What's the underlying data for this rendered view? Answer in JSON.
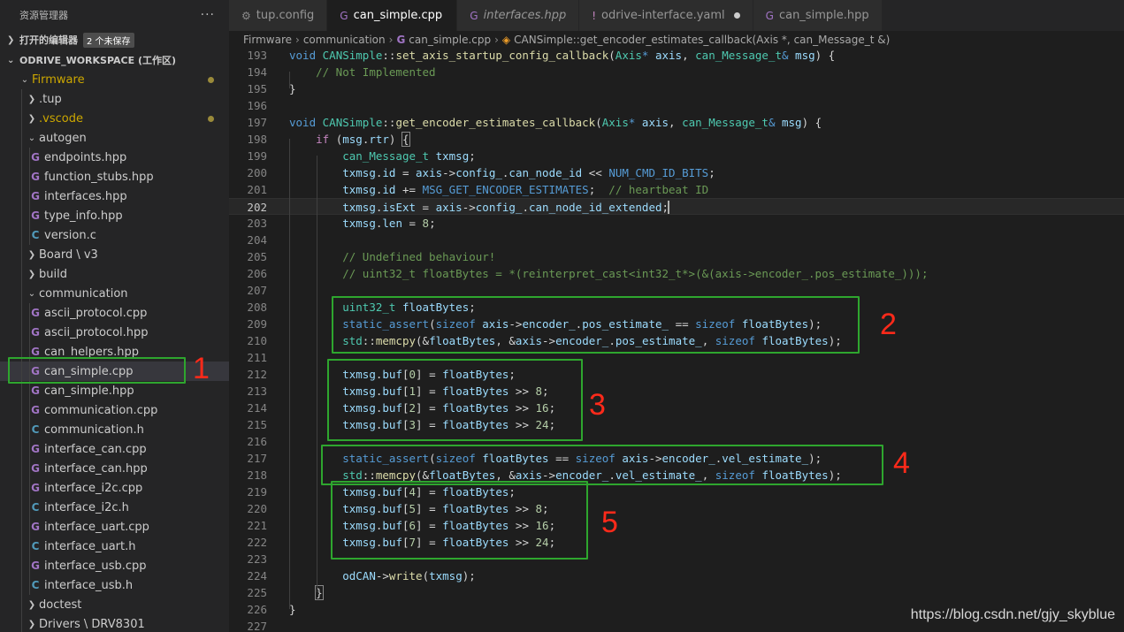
{
  "explorer": {
    "title": "资源管理器",
    "more_icon": "ellipsis-icon",
    "open_editors_label": "打开的编辑器",
    "unsaved_badge": "2 个未保存",
    "workspace_label": "ODRIVE_WORKSPACE (工作区)",
    "tree": [
      {
        "label": "Firmware",
        "depth": 1,
        "chev": "v",
        "modified": true
      },
      {
        "label": ".tup",
        "depth": 2,
        "chev": ">"
      },
      {
        "label": ".vscode",
        "depth": 2,
        "chev": ">",
        "modified": true
      },
      {
        "label": "autogen",
        "depth": 2,
        "chev": "v"
      },
      {
        "label": "endpoints.hpp",
        "depth": 3,
        "icon": "cpp"
      },
      {
        "label": "function_stubs.hpp",
        "depth": 3,
        "icon": "cpp"
      },
      {
        "label": "interfaces.hpp",
        "depth": 3,
        "icon": "cpp"
      },
      {
        "label": "type_info.hpp",
        "depth": 3,
        "icon": "cpp"
      },
      {
        "label": "version.c",
        "depth": 3,
        "icon": "c"
      },
      {
        "label": "Board \\ v3",
        "depth": 2,
        "chev": ">"
      },
      {
        "label": "build",
        "depth": 2,
        "chev": ">"
      },
      {
        "label": "communication",
        "depth": 2,
        "chev": "v"
      },
      {
        "label": "ascii_protocol.cpp",
        "depth": 3,
        "icon": "cpp"
      },
      {
        "label": "ascii_protocol.hpp",
        "depth": 3,
        "icon": "cpp"
      },
      {
        "label": "can_helpers.hpp",
        "depth": 3,
        "icon": "cpp"
      },
      {
        "label": "can_simple.cpp",
        "depth": 3,
        "icon": "cpp",
        "selected": true
      },
      {
        "label": "can_simple.hpp",
        "depth": 3,
        "icon": "cpp"
      },
      {
        "label": "communication.cpp",
        "depth": 3,
        "icon": "cpp"
      },
      {
        "label": "communication.h",
        "depth": 3,
        "icon": "c"
      },
      {
        "label": "interface_can.cpp",
        "depth": 3,
        "icon": "cpp"
      },
      {
        "label": "interface_can.hpp",
        "depth": 3,
        "icon": "cpp"
      },
      {
        "label": "interface_i2c.cpp",
        "depth": 3,
        "icon": "cpp"
      },
      {
        "label": "interface_i2c.h",
        "depth": 3,
        "icon": "c"
      },
      {
        "label": "interface_uart.cpp",
        "depth": 3,
        "icon": "cpp"
      },
      {
        "label": "interface_uart.h",
        "depth": 3,
        "icon": "c"
      },
      {
        "label": "interface_usb.cpp",
        "depth": 3,
        "icon": "cpp"
      },
      {
        "label": "interface_usb.h",
        "depth": 3,
        "icon": "c"
      },
      {
        "label": "doctest",
        "depth": 2,
        "chev": ">"
      },
      {
        "label": "Drivers \\ DRV8301",
        "depth": 2,
        "chev": ">"
      }
    ]
  },
  "tabs": [
    {
      "label": "tup.config",
      "icon": "gear-icon",
      "glyph": "⚙",
      "color": "#8a8a8a"
    },
    {
      "label": "can_simple.cpp",
      "icon": "cpp-file-icon",
      "glyph": "G",
      "color": "#a074c4",
      "active": true,
      "dot": true
    },
    {
      "label": "interfaces.hpp",
      "icon": "cpp-file-icon",
      "glyph": "G",
      "color": "#a074c4",
      "italic": true
    },
    {
      "label": "odrive-interface.yaml",
      "icon": "yaml-file-icon",
      "glyph": "!",
      "color": "#c586c0",
      "dot": true
    },
    {
      "label": "can_simple.hpp",
      "icon": "cpp-file-icon",
      "glyph": "G",
      "color": "#a074c4"
    }
  ],
  "breadcrumb": {
    "parts": [
      "Firmware",
      "communication",
      "can_simple.cpp"
    ],
    "symbol": "CANSimple::get_encoder_estimates_callback(Axis *, can_Message_t &)"
  },
  "code_lines": [
    {
      "n": "193",
      "html": "<span class='kw'>void</span> <span class='ty'>CANSimple</span>::<span class='fn'>set_axis_startup_config_callback</span>(<span class='ty'>Axis</span><span class='kw'>*</span> <span class='var'>axis</span>, <span class='ty'>can_Message_t</span><span class='kw'>&amp;</span> <span class='var'>msg</span>) {"
    },
    {
      "n": "194",
      "html": "    <span class='cm'>// Not Implemented</span>"
    },
    {
      "n": "195",
      "html": "}"
    },
    {
      "n": "196",
      "html": ""
    },
    {
      "n": "197",
      "html": "<span class='kw'>void</span> <span class='ty'>CANSimple</span>::<span class='fn'>get_encoder_estimates_callback</span>(<span class='ty'>Axis</span><span class='kw'>*</span> <span class='var'>axis</span>, <span class='ty'>can_Message_t</span><span class='kw'>&amp;</span> <span class='var'>msg</span>) {"
    },
    {
      "n": "198",
      "html": "    <span class='ctl'>if</span> (<span class='var'>msg</span>.<span class='var'>rtr</span>) <span class='brk'>{</span>"
    },
    {
      "n": "199",
      "html": "        <span class='ty'>can_Message_t</span> <span class='var'>txmsg</span>;"
    },
    {
      "n": "200",
      "html": "        <span class='var'>txmsg</span>.<span class='var'>id</span> = <span class='var'>axis</span>-&gt;<span class='var'>config_</span>.<span class='var'>can_node_id</span> &lt;&lt; <span class='mac'>NUM_CMD_ID_BITS</span>;"
    },
    {
      "n": "201",
      "html": "        <span class='var'>txmsg</span>.<span class='var'>id</span> += <span class='mac'>MSG_GET_ENCODER_ESTIMATES</span>;  <span class='cm'>// heartbeat ID</span>"
    },
    {
      "n": "202",
      "html": "        <span class='var'>txmsg</span>.<span class='var'>isExt</span> = <span class='var'>axis</span>-&gt;<span class='var'>config_</span>.<span class='var'>can_node_id_extended</span>;<span class='cur'></span>",
      "current": true
    },
    {
      "n": "203",
      "html": "        <span class='var'>txmsg</span>.<span class='var'>len</span> = <span class='num'>8</span>;"
    },
    {
      "n": "204",
      "html": ""
    },
    {
      "n": "205",
      "html": "        <span class='cm'>// Undefined behaviour!</span>"
    },
    {
      "n": "206",
      "html": "        <span class='cm'>// uint32_t floatBytes = *(reinterpret_cast&lt;int32_t*&gt;(&amp;(axis-&gt;encoder_.pos_estimate_)));</span>"
    },
    {
      "n": "207",
      "html": ""
    },
    {
      "n": "208",
      "html": "        <span class='ty'>uint32_t</span> <span class='var'>floatBytes</span>;"
    },
    {
      "n": "209",
      "html": "        <span class='kw'>static_assert</span>(<span class='kw'>sizeof</span> <span class='var'>axis</span>-&gt;<span class='var'>encoder_</span>.<span class='var'>pos_estimate_</span> == <span class='kw'>sizeof</span> <span class='var'>floatBytes</span>);"
    },
    {
      "n": "210",
      "html": "        <span class='ty'>std</span>::<span class='fn'>memcpy</span>(&amp;<span class='var'>floatBytes</span>, &amp;<span class='var'>axis</span>-&gt;<span class='var'>encoder_</span>.<span class='var'>pos_estimate_</span>, <span class='kw'>sizeof</span> <span class='var'>floatBytes</span>);"
    },
    {
      "n": "211",
      "html": ""
    },
    {
      "n": "212",
      "html": "        <span class='var'>txmsg</span>.<span class='var'>buf</span>[<span class='num'>0</span>] = <span class='var'>floatBytes</span>;"
    },
    {
      "n": "213",
      "html": "        <span class='var'>txmsg</span>.<span class='var'>buf</span>[<span class='num'>1</span>] = <span class='var'>floatBytes</span> &gt;&gt; <span class='num'>8</span>;"
    },
    {
      "n": "214",
      "html": "        <span class='var'>txmsg</span>.<span class='var'>buf</span>[<span class='num'>2</span>] = <span class='var'>floatBytes</span> &gt;&gt; <span class='num'>16</span>;"
    },
    {
      "n": "215",
      "html": "        <span class='var'>txmsg</span>.<span class='var'>buf</span>[<span class='num'>3</span>] = <span class='var'>floatBytes</span> &gt;&gt; <span class='num'>24</span>;"
    },
    {
      "n": "216",
      "html": ""
    },
    {
      "n": "217",
      "html": "        <span class='kw'>static_assert</span>(<span class='kw'>sizeof</span> <span class='var'>floatBytes</span> == <span class='kw'>sizeof</span> <span class='var'>axis</span>-&gt;<span class='var'>encoder_</span>.<span class='var'>vel_estimate_</span>);"
    },
    {
      "n": "218",
      "html": "        <span class='ty'>std</span>::<span class='fn'>memcpy</span>(&amp;<span class='var'>floatBytes</span>, &amp;<span class='var'>axis</span>-&gt;<span class='var'>encoder_</span>.<span class='var'>vel_estimate_</span>, <span class='kw'>sizeof</span> <span class='var'>floatBytes</span>);"
    },
    {
      "n": "219",
      "html": "        <span class='var'>txmsg</span>.<span class='var'>buf</span>[<span class='num'>4</span>] = <span class='var'>floatBytes</span>;"
    },
    {
      "n": "220",
      "html": "        <span class='var'>txmsg</span>.<span class='var'>buf</span>[<span class='num'>5</span>] = <span class='var'>floatBytes</span> &gt;&gt; <span class='num'>8</span>;"
    },
    {
      "n": "221",
      "html": "        <span class='var'>txmsg</span>.<span class='var'>buf</span>[<span class='num'>6</span>] = <span class='var'>floatBytes</span> &gt;&gt; <span class='num'>16</span>;"
    },
    {
      "n": "222",
      "html": "        <span class='var'>txmsg</span>.<span class='var'>buf</span>[<span class='num'>7</span>] = <span class='var'>floatBytes</span> &gt;&gt; <span class='num'>24</span>;"
    },
    {
      "n": "223",
      "html": ""
    },
    {
      "n": "224",
      "html": "        <span class='var'>odCAN</span>-&gt;<span class='fn'>write</span>(<span class='var'>txmsg</span>);"
    },
    {
      "n": "225",
      "html": "    <span class='brk'>}</span>"
    },
    {
      "n": "226",
      "html": "}"
    },
    {
      "n": "227",
      "html": ""
    }
  ],
  "annotations": [
    "1",
    "2",
    "3",
    "4",
    "5"
  ],
  "annotation_color": "#ff2a1a",
  "highlight_color": "#2ea62e",
  "watermark": "https://blog.csdn.net/gjy_skyblue"
}
